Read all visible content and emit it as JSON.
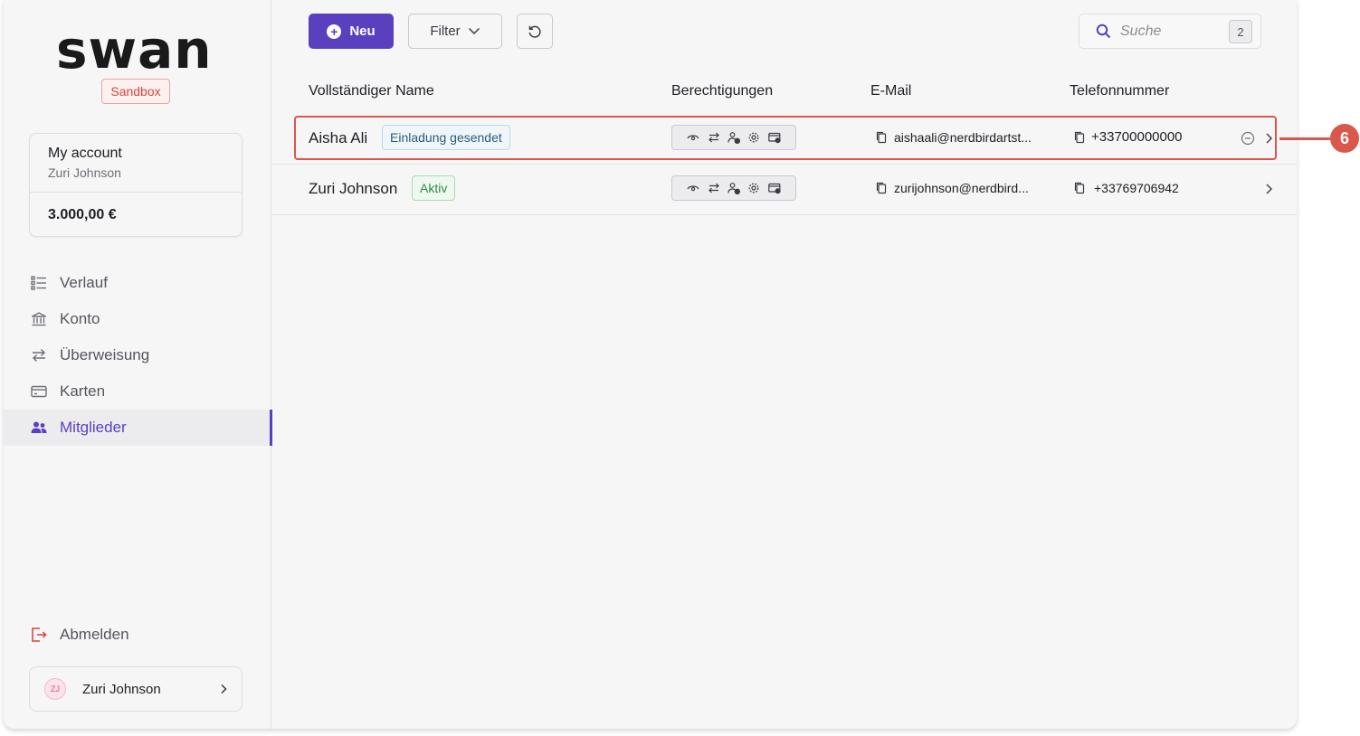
{
  "sidebar": {
    "logo": "swan",
    "environment": "Sandbox",
    "account": {
      "title": "My account",
      "holder": "Zuri Johnson",
      "balance": "3.000,00 €"
    },
    "nav": [
      {
        "label": "Verlauf",
        "icon": "list-icon"
      },
      {
        "label": "Konto",
        "icon": "bank-icon"
      },
      {
        "label": "Überweisung",
        "icon": "transfer-icon"
      },
      {
        "label": "Karten",
        "icon": "card-icon"
      },
      {
        "label": "Mitglieder",
        "icon": "members-icon",
        "active": true
      }
    ],
    "logout_label": "Abmelden",
    "user": {
      "initials": "ZJ",
      "name": "Zuri Johnson"
    }
  },
  "toolbar": {
    "new_label": "Neu",
    "filter_label": "Filter",
    "search_placeholder": "Suche",
    "search_count": "2"
  },
  "table": {
    "columns": [
      "Vollständiger Name",
      "Berechtigungen",
      "E-Mail",
      "Telefonnummer"
    ],
    "rows": [
      {
        "name": "Aisha Ali",
        "status": "Einladung gesendet",
        "email": "aishaali@nerdbirdartst...",
        "phone": "+33700000000"
      },
      {
        "name": "Zuri Johnson",
        "status": "Aktiv",
        "email": "zurijohnson@nerdbird...",
        "phone": "+33769706942"
      }
    ]
  },
  "annotation": {
    "number": "6",
    "color": "#d9574b"
  },
  "colors": {
    "accent": "#5a3fbf",
    "danger": "#d4453c"
  }
}
